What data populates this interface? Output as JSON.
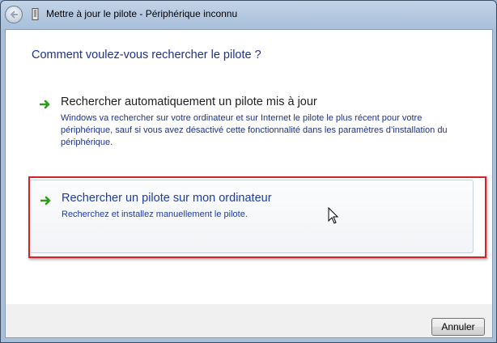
{
  "window": {
    "title": "Mettre à jour le pilote - Périphérique inconnu"
  },
  "page": {
    "heading": "Comment voulez-vous rechercher le pilote ?",
    "options": [
      {
        "title": "Rechercher automatiquement un pilote mis à jour",
        "description": "Windows va rechercher sur votre ordinateur et sur Internet le pilote le plus récent pour votre périphérique, sauf si vous avez désactivé cette fonctionnalité dans les paramètres d’installation du périphérique.",
        "icon": "green-arrow-icon"
      },
      {
        "title": "Rechercher un pilote sur mon ordinateur",
        "description": "Recherchez et installez manuellement le pilote.",
        "icon": "green-arrow-icon",
        "highlighted": true
      }
    ]
  },
  "footer": {
    "cancel_label": "Annuler"
  },
  "colors": {
    "heading": "#1e3287",
    "link": "#1e3ca0",
    "highlight_border": "#d2232a",
    "arrow": "#2e9a1f"
  }
}
